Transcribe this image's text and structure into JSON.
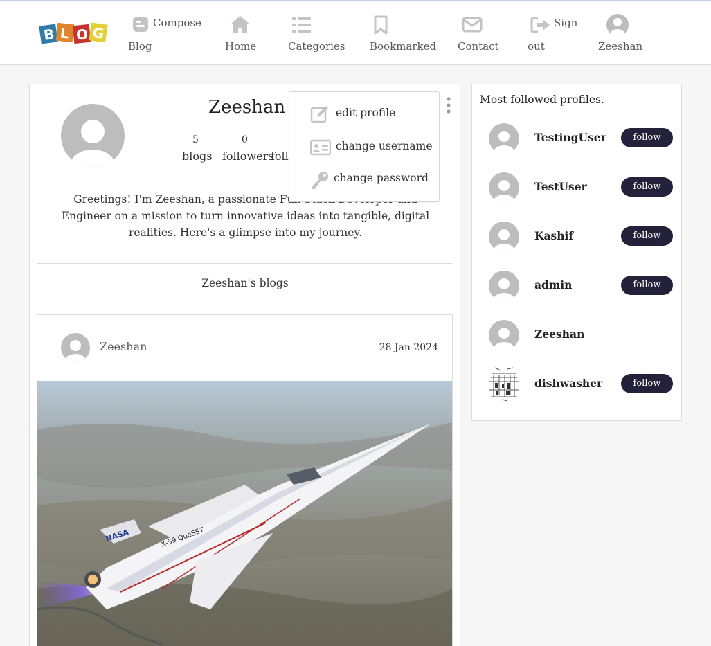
{
  "nav": {
    "logo_text": "BLOG",
    "items": [
      {
        "label_top": "Compose",
        "label_bottom": "Blog"
      },
      {
        "label": "Home"
      },
      {
        "label": "Categories"
      },
      {
        "label": "Bookmarked"
      },
      {
        "label": "Contact"
      },
      {
        "label_top": "Sign",
        "label_bottom": "out"
      },
      {
        "label": "Zeeshan"
      }
    ]
  },
  "profile": {
    "name": "Zeeshan",
    "stats": [
      {
        "value": "5",
        "label": "blogs"
      },
      {
        "value": "0",
        "label": "followers"
      },
      {
        "value": "",
        "label": "following"
      }
    ],
    "bio": "Greetings! I'm Zeeshan, a passionate Full Stack Developer and Engineer on a mission to turn innovative ideas into tangible, digital realities. Here's a glimpse into my journey.",
    "blogs_heading": "Zeeshan's blogs"
  },
  "dropdown": {
    "items": [
      "edit profile",
      "change username",
      "change password"
    ]
  },
  "post": {
    "author": "Zeeshan",
    "date": "28 Jan 2024",
    "image_text_nasa": "NASA",
    "image_text_model": "X-59 QueSST"
  },
  "sidebar": {
    "title": "Most followed profiles.",
    "profiles": [
      {
        "name": "TestingUser",
        "button": "follow"
      },
      {
        "name": "TestUser",
        "button": "follow"
      },
      {
        "name": "Kashif",
        "button": "follow"
      },
      {
        "name": "admin",
        "button": "follow"
      },
      {
        "name": "Zeeshan",
        "button": ""
      },
      {
        "name": "dishwasher",
        "button": "follow"
      }
    ]
  },
  "colors": {
    "nav_icon": "#c4c4c8",
    "button_bg": "#23223a",
    "avatar_gray": "#bdbdbd"
  }
}
